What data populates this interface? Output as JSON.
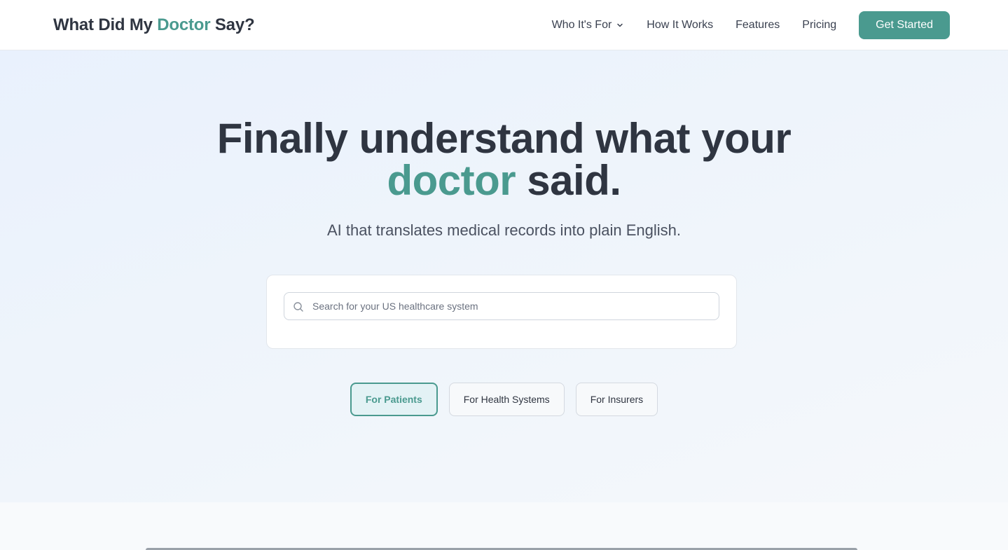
{
  "brand": {
    "logo_pre": "What Did My ",
    "logo_accent": "Doctor",
    "logo_post": " Say?",
    "accent_color": "#4a9a8f"
  },
  "nav": {
    "items": [
      {
        "label": "Who It's For",
        "has_dropdown": true,
        "icon": "chevron-down-icon"
      },
      {
        "label": "How It Works"
      },
      {
        "label": "Features"
      },
      {
        "label": "Pricing"
      }
    ],
    "cta_label": "Get Started"
  },
  "hero": {
    "headline_line1": "Finally understand what your",
    "headline_accent": "doctor",
    "headline_rest": " said.",
    "subheadline": "AI that translates medical records into plain English.",
    "search": {
      "placeholder": "Search for your US healthcare system",
      "value": "",
      "icon": "search-icon"
    },
    "audience_tabs": [
      {
        "label": "For Patients",
        "active": true
      },
      {
        "label": "For Health Systems",
        "active": false
      },
      {
        "label": "For Insurers",
        "active": false
      }
    ]
  }
}
